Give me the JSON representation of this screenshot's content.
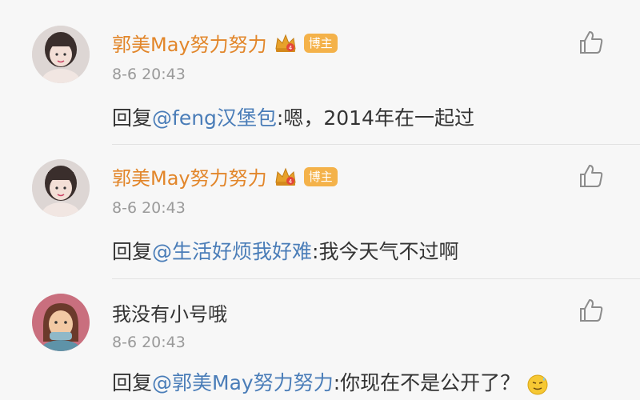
{
  "comments": [
    {
      "name": "郭美May努力努力",
      "badge": "博主",
      "time": "8-6 20:43",
      "reply_prefix": "回复",
      "mention": "@feng汉堡包",
      "body": ":嗯，2014年在一起过"
    },
    {
      "name": "郭美May努力努力",
      "badge": "博主",
      "time": "8-6 20:43",
      "reply_prefix": "回复",
      "mention": "@生活好烦我好难",
      "body": ":我今天气不过啊"
    },
    {
      "name": "我没有小号哦",
      "time": "8-6 20:43",
      "reply_prefix": "回复",
      "mention": "@郭美May努力努力",
      "body": ":你现在不是公开了？"
    }
  ],
  "colors": {
    "username": "#e2862a",
    "mention": "#4a7db8",
    "badge_bg": "#f4b24a",
    "time": "#9a9a9a"
  },
  "icons": {
    "like": "thumbs-up-icon",
    "crown": "crown-icon",
    "emoji": "sweat-smile-emoji-icon"
  }
}
